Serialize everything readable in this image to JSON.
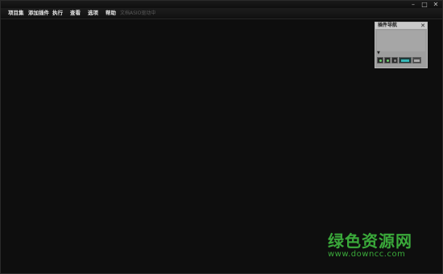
{
  "window": {
    "controls": {
      "minimize": "–",
      "maximize": "□",
      "close": "✕"
    }
  },
  "menubar": {
    "items": [
      {
        "label": "项目集"
      },
      {
        "label": "添加插件"
      },
      {
        "label": "执行"
      },
      {
        "label": "查看"
      },
      {
        "label": "选项"
      },
      {
        "label": "帮助"
      }
    ],
    "status": "文档ASIO驱动中"
  },
  "nav_panel": {
    "title": "插件导航",
    "close": "✕",
    "expand": "▼",
    "icons": [
      "plugin-green-icon",
      "plugin-green-icon",
      "plugin-icon",
      "plugin-teal-icon",
      "plugin-grey-icon"
    ]
  },
  "watermark": {
    "cn": "绿色资源网",
    "url": "www.downcc.com"
  },
  "colors": {
    "background": "#0e0e0e",
    "watermark": "#3aa93a",
    "panel": "#9e9e9e"
  }
}
